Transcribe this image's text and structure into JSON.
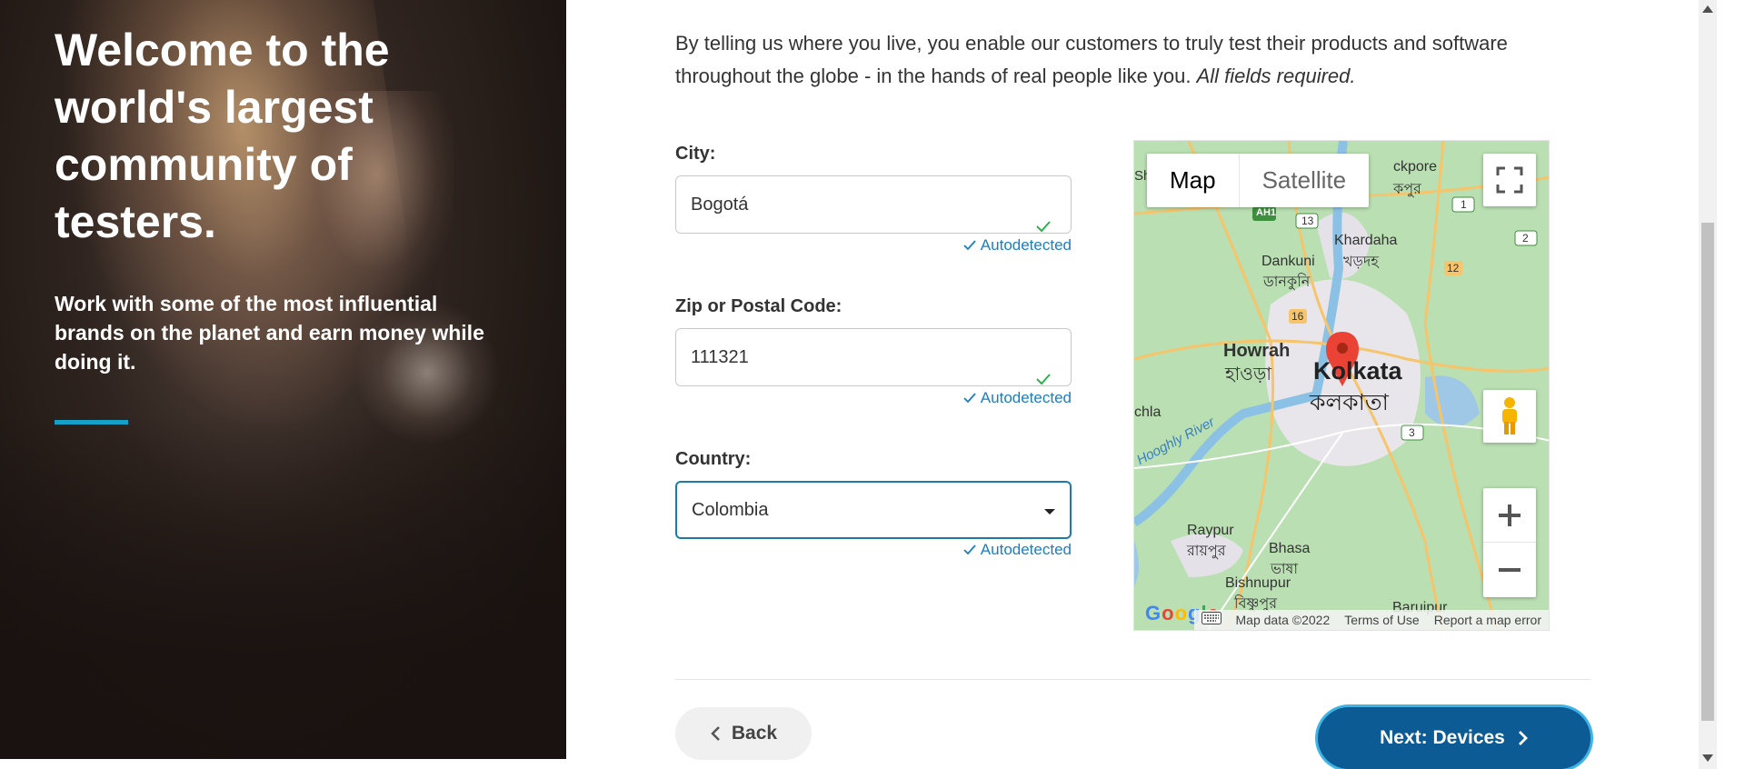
{
  "hero": {
    "title": "Welcome to the world's largest community of testers.",
    "subtitle": "Work with some of the most influential brands on the planet and earn money while doing it."
  },
  "intro": {
    "text": "By telling us where you live, you enable our customers to truly test their products and software throughout the globe - in the hands of real people like you. ",
    "required_note": "All fields required."
  },
  "form": {
    "city": {
      "label": "City:",
      "value": "Bogotá",
      "status": "Autodetected"
    },
    "zip": {
      "label": "Zip or Postal Code:",
      "value": "111321",
      "status": "Autodetected"
    },
    "country": {
      "label": "Country:",
      "value": "Colombia",
      "status": "Autodetected"
    }
  },
  "map": {
    "type_map": "Map",
    "type_satellite": "Satellite",
    "labels": {
      "kolkata_en": "Kolkata",
      "kolkata_bn": "কলকাতা",
      "howrah_en": "Howrah",
      "howrah_bn": "হাওড়া",
      "dankuni_en": "Dankuni",
      "dankuni_bn": "ডানকুনি",
      "khardaha_en": "Khardaha",
      "khardaha_bn": "খড়দহ",
      "raypur_en": "Raypur",
      "raypur_bn": "রায়পুর",
      "bhasa_en": "Bhasa",
      "bhasa_bn": "ভাষা",
      "bishnupur_en": "Bishnupur",
      "bishnupur_bn": "বিষ্ণুপুর",
      "baruipur": "Baruipur",
      "river": "Hooghly River",
      "barrackpore": "ckpore",
      "barrackpore_bn": "কপুর",
      "uluberia_fragment": "chla",
      "sh_fragment": "Sh",
      "shields": [
        "AH1",
        "13",
        "1",
        "2",
        "12",
        "16",
        "3"
      ]
    },
    "google": "Google",
    "footer": {
      "data": "Map data ©2022",
      "terms": "Terms of Use",
      "report": "Report a map error"
    }
  },
  "actions": {
    "back": "Back",
    "next": "Next: Devices"
  }
}
